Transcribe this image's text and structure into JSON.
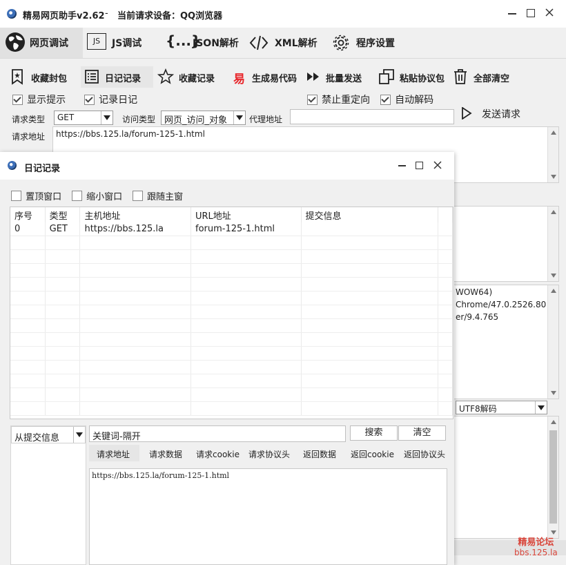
{
  "main": {
    "title": "精易网页助手v2.62",
    "title_sep": "-",
    "device_label": "当前请求设备：QQ浏览器",
    "tabs": [
      {
        "label": "网页调试",
        "icon": "globe-icon"
      },
      {
        "label": "JS调试",
        "icon": "js-icon"
      },
      {
        "label": "JSON解析",
        "icon": "braces-icon"
      },
      {
        "label": "XML解析",
        "icon": "code-icon"
      },
      {
        "label": "程序设置",
        "icon": "gear-icon"
      }
    ],
    "js_icon_text": "JS",
    "braces_icon_text": "{...}",
    "toolbar": [
      {
        "label": "收藏封包",
        "icon": "bookmark-icon"
      },
      {
        "label": "日记记录",
        "icon": "list-icon"
      },
      {
        "label": "收藏记录",
        "icon": "star-icon"
      },
      {
        "label": "生成易代码",
        "icon": "yi-icon"
      },
      {
        "label": "批量发送",
        "icon": "fast-forward-icon"
      },
      {
        "label": "粘贴协议包",
        "icon": "paste-icon"
      },
      {
        "label": "全部清空",
        "icon": "trash-icon"
      }
    ],
    "yi_icon_text": "易",
    "options": {
      "show_tips": "显示提示",
      "record_log": "记录日记",
      "no_redirect": "禁止重定向",
      "auto_decode": "自动解码"
    },
    "request_type_label": "请求类型",
    "request_type_value": "GET",
    "access_type_label": "访问类型",
    "access_type_value": "网页_访问_对象",
    "proxy_label": "代理地址",
    "proxy_value": "",
    "send_button": "发送请求",
    "url_label": "请求地址",
    "url_value": "https://bbs.125.la/forum-125-1.html",
    "ua_lines": [
      "WOW64)",
      "Chrome/47.0.2526.80",
      "er/9.4.765"
    ],
    "decode_select": "UTF8解码",
    "watermark": {
      "line1": "精易论坛",
      "line2": "bbs.125.la"
    }
  },
  "log_window": {
    "title": "日记记录",
    "options": {
      "topmost": "置顶窗口",
      "shrink": "缩小窗口",
      "follow": "跟随主窗"
    },
    "columns": [
      "序号",
      "类型",
      "主机地址",
      "URL地址",
      "提交信息"
    ],
    "rows": [
      [
        "0",
        "GET",
        "https://bbs.125.la",
        "forum-125-1.html",
        ""
      ]
    ],
    "filter_select": "从提交信息",
    "keyword_input": "关键词-隔开",
    "search_button": "搜索",
    "clear_button": "清空",
    "detail_tabs": [
      "请求地址",
      "请求数据",
      "请求cookie",
      "请求协议头",
      "返回数据",
      "返回cookie",
      "返回协议头"
    ],
    "detail_text": "https://bbs.125.la/forum-125-1.html"
  },
  "colors": {
    "accent_red": "#e8262b",
    "watermark": "#d9453a",
    "toolbar_active": "#e6e6e6"
  }
}
